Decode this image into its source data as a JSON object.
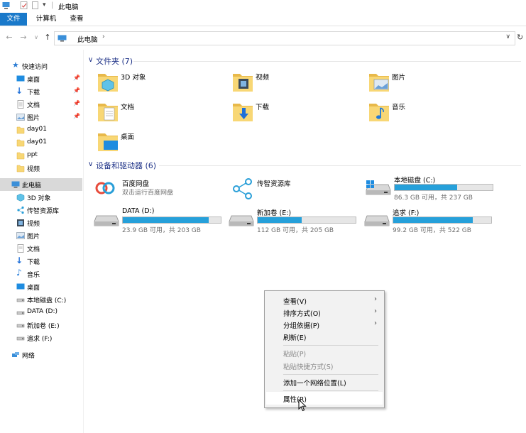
{
  "window": {
    "title": "此电脑"
  },
  "ribbon": {
    "tabs": [
      {
        "label": "文件"
      },
      {
        "label": "计算机"
      },
      {
        "label": "查看"
      }
    ]
  },
  "address": {
    "path": "此电脑"
  },
  "sidebar": {
    "quick_access": "快速访问",
    "quick_items": [
      {
        "label": "桌面"
      },
      {
        "label": "下载"
      },
      {
        "label": "文档"
      },
      {
        "label": "图片"
      },
      {
        "label": "day01"
      },
      {
        "label": "day01"
      },
      {
        "label": "ppt"
      },
      {
        "label": "视频"
      }
    ],
    "this_pc": "此电脑",
    "pc_items": [
      {
        "label": "3D 对象"
      },
      {
        "label": "传智资源库"
      },
      {
        "label": "视频"
      },
      {
        "label": "图片"
      },
      {
        "label": "文档"
      },
      {
        "label": "下载"
      },
      {
        "label": "音乐"
      },
      {
        "label": "桌面"
      },
      {
        "label": "本地磁盘 (C:)"
      },
      {
        "label": "DATA (D:)"
      },
      {
        "label": "新加卷 (E:)"
      },
      {
        "label": "追求 (F:)"
      }
    ],
    "network": "网络"
  },
  "folders_group": {
    "title": "文件夹 (7)"
  },
  "folders": [
    {
      "label": "3D 对象"
    },
    {
      "label": "视频"
    },
    {
      "label": "图片"
    },
    {
      "label": "文档"
    },
    {
      "label": "下载"
    },
    {
      "label": "音乐"
    },
    {
      "label": "桌面"
    }
  ],
  "devices_group": {
    "title": "设备和驱动器 (6)"
  },
  "devices": {
    "baidu": {
      "name": "百度网盘",
      "sub": "双击运行百度网盘"
    },
    "chuanzhi": {
      "name": "传智资源库"
    },
    "c": {
      "name": "本地磁盘 (C:)",
      "info": "86.3 GB 可用，共 237 GB",
      "used_fraction": 0.64
    },
    "d": {
      "name": "DATA (D:)",
      "info": "23.9 GB 可用，共 203 GB",
      "used_fraction": 0.88
    },
    "e": {
      "name": "新加卷 (E:)",
      "info": "112 GB 可用，共 205 GB",
      "used_fraction": 0.45
    },
    "f": {
      "name": "追求 (F:)",
      "info": "99.2 GB 可用，共 522 GB",
      "used_fraction": 0.81
    }
  },
  "context_menu": {
    "view": "查看(V)",
    "sort": "排序方式(O)",
    "group": "分组依据(P)",
    "refresh": "刷新(E)",
    "paste": "粘贴(P)",
    "paste_shortcut": "粘贴快捷方式(S)",
    "add_network": "添加一个网络位置(L)",
    "properties": "属性(R)"
  },
  "colors": {
    "accent": "#1979ca",
    "bar_fill": "#26a0da",
    "group_title": "#1e3287",
    "folder": "#f8d775"
  }
}
